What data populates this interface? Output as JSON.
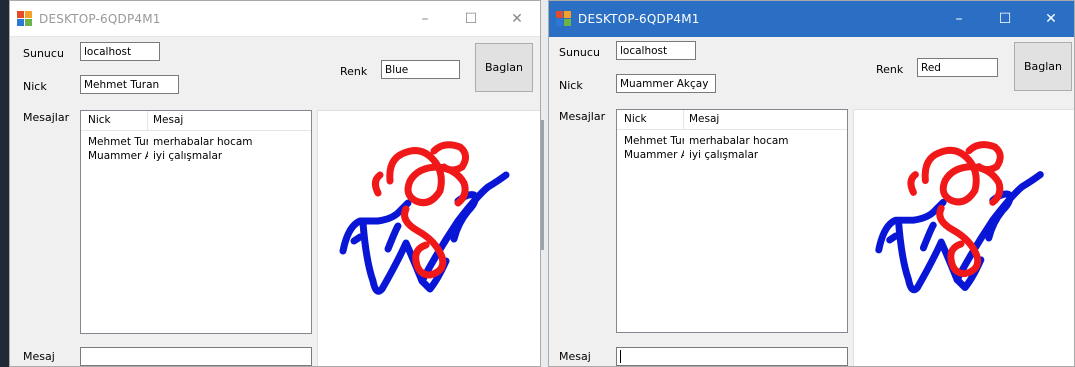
{
  "windows": [
    {
      "title": "DESKTOP-6QDP4M1",
      "active": false,
      "labels": {
        "sunucu": "Sunucu",
        "nick": "Nick",
        "renk": "Renk",
        "mesajlar": "Mesajlar",
        "mesaj": "Mesaj"
      },
      "sunucu_value": "localhost",
      "nick_value": "Mehmet Turan",
      "renk_value": "Blue",
      "connect_button": "Baglan",
      "columns": [
        "Nick",
        "Mesaj"
      ],
      "rows": [
        {
          "nick": "Mehmet Turan",
          "mesaj": "merhabalar hocam"
        },
        {
          "nick": "Muammer Ak...",
          "mesaj": "iyi çalışmalar"
        }
      ],
      "mesaj_value": ""
    },
    {
      "title": "DESKTOP-6QDP4M1",
      "active": true,
      "labels": {
        "sunucu": "Sunucu",
        "nick": "Nick",
        "renk": "Renk",
        "mesajlar": "Mesajlar",
        "mesaj": "Mesaj"
      },
      "sunucu_value": "localhost",
      "nick_value": "Muammer Akçay",
      "renk_value": "Red",
      "connect_button": "Baglan",
      "columns": [
        "Nick",
        "Mesaj"
      ],
      "rows": [
        {
          "nick": "Mehmet Turan",
          "mesaj": "merhabalar hocam"
        },
        {
          "nick": "Muammer Ak...",
          "mesaj": "iyi çalışmalar"
        }
      ],
      "mesaj_value": ""
    }
  ],
  "title_controls": {
    "minimize": "–",
    "maximize": "☐",
    "close": "✕"
  },
  "drawing_colors": {
    "blue": "#0a16d6",
    "red": "#f01818"
  }
}
